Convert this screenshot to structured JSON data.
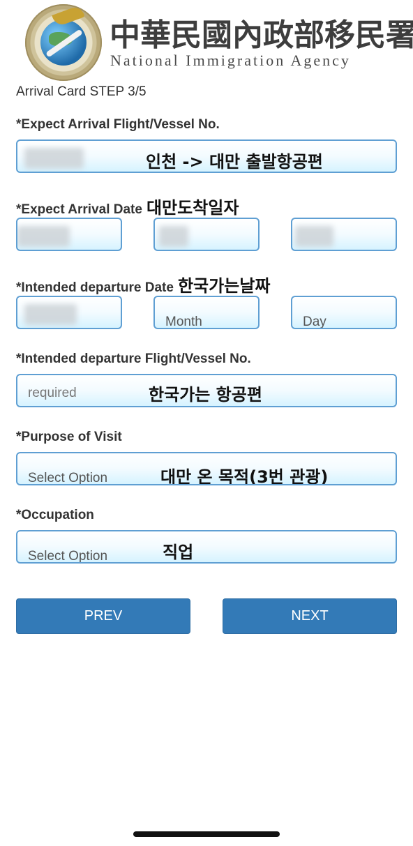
{
  "header": {
    "title_cn": "中華民國內政部移民署",
    "title_en": "National Immigration Agency",
    "logo_text": "National Immigration Agency"
  },
  "form": {
    "step": "Arrival Card STEP 3/5",
    "arrival_flight": {
      "label": "*Expect Arrival Flight/Vessel No.",
      "note": "인천 -> 대만 출발항공편"
    },
    "arrival_date": {
      "label": "*Expect Arrival Date",
      "note": "대만도착일자"
    },
    "departure_date": {
      "label": "*Intended departure Date",
      "note": "한국가는날짜",
      "month_placeholder": "Month",
      "day_placeholder": "Day"
    },
    "departure_flight": {
      "label": "*Intended departure Flight/Vessel No.",
      "placeholder": "required",
      "note": "한국가는 항공편"
    },
    "purpose": {
      "label": "*Purpose of Visit",
      "value": "Select Option",
      "note": "대만 온 목적(3번 관광)"
    },
    "occupation": {
      "label": "*Occupation",
      "value": "Select Option",
      "note": "직업"
    }
  },
  "buttons": {
    "prev": "PREV",
    "next": "NEXT"
  },
  "colors": {
    "accent": "#337ab7",
    "field_border": "#5f9fd3"
  }
}
